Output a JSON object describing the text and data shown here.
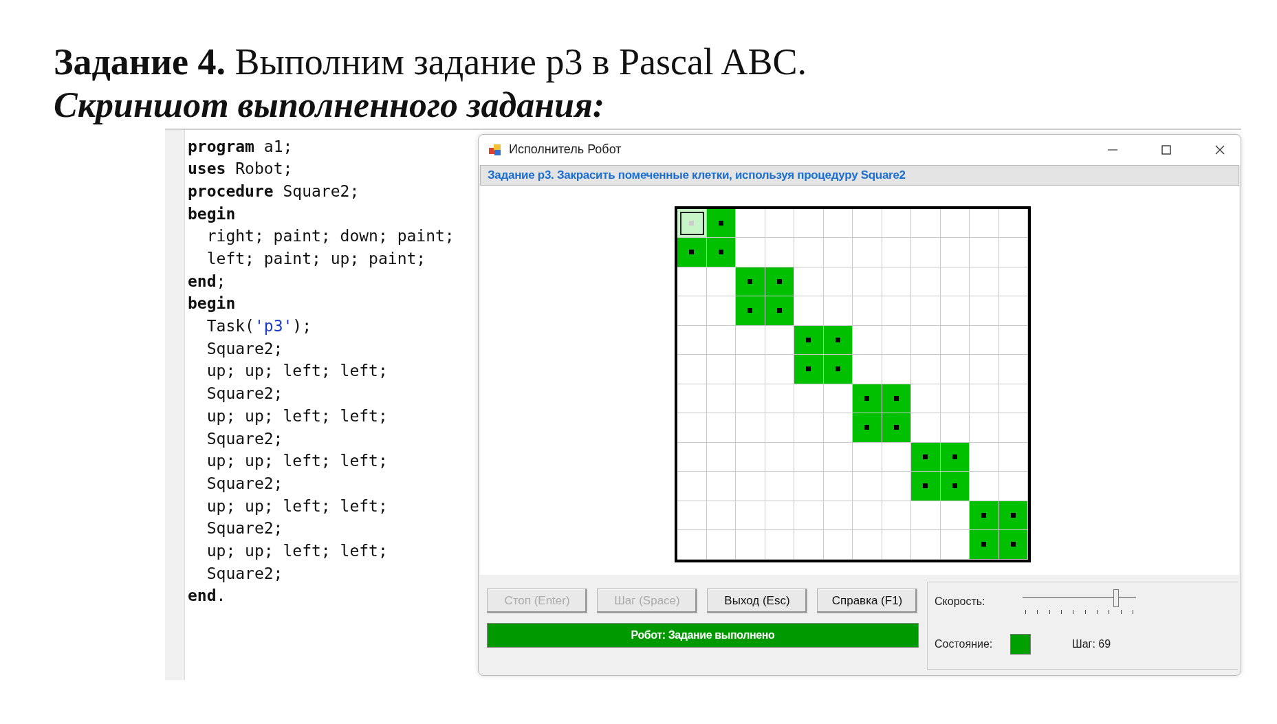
{
  "heading": {
    "number": "Задание 4.",
    "text": "Выполним задание р3 в Pascal ABC."
  },
  "subheading": "Скриншот выполненного задания:",
  "editor": {
    "lines": [
      [
        {
          "kind": "keyword",
          "text": "program"
        },
        {
          "kind": "plain",
          "text": " a1;"
        }
      ],
      [
        {
          "kind": "keyword",
          "text": "uses"
        },
        {
          "kind": "plain",
          "text": " Robot;"
        }
      ],
      [
        {
          "kind": "keyword",
          "text": "procedure"
        },
        {
          "kind": "plain",
          "text": " Square2;"
        }
      ],
      [
        {
          "kind": "keyword",
          "text": "begin"
        }
      ],
      [
        {
          "kind": "plain",
          "text": "  right; paint; down; paint;"
        }
      ],
      [
        {
          "kind": "plain",
          "text": "  left; paint; up; paint;"
        }
      ],
      [
        {
          "kind": "keyword",
          "text": "end"
        },
        {
          "kind": "plain",
          "text": ";"
        }
      ],
      [
        {
          "kind": "keyword",
          "text": "begin"
        }
      ],
      [
        {
          "kind": "plain",
          "text": "  Task("
        },
        {
          "kind": "string",
          "text": "'p3'"
        },
        {
          "kind": "plain",
          "text": ");"
        }
      ],
      [
        {
          "kind": "plain",
          "text": "  Square2;"
        }
      ],
      [
        {
          "kind": "plain",
          "text": "  up; up; left; left;"
        }
      ],
      [
        {
          "kind": "plain",
          "text": "  Square2;"
        }
      ],
      [
        {
          "kind": "plain",
          "text": "  up; up; left; left;"
        }
      ],
      [
        {
          "kind": "plain",
          "text": "  Square2;"
        }
      ],
      [
        {
          "kind": "plain",
          "text": "  up; up; left; left;"
        }
      ],
      [
        {
          "kind": "plain",
          "text": "  Square2;"
        }
      ],
      [
        {
          "kind": "plain",
          "text": "  up; up; left; left;"
        }
      ],
      [
        {
          "kind": "plain",
          "text": "  Square2;"
        }
      ],
      [
        {
          "kind": "plain",
          "text": "  up; up; left; left;"
        }
      ],
      [
        {
          "kind": "plain",
          "text": "  Square2;"
        }
      ],
      [
        {
          "kind": "keyword",
          "text": "end"
        },
        {
          "kind": "plain",
          "text": "."
        }
      ]
    ]
  },
  "window": {
    "title": "Исполнитель Робот",
    "task": "Задание р3. Закрасить помеченные клетки, используя процедуру Square2",
    "grid": [
      [
        {
          "painted": true,
          "marked": true,
          "robot": true
        },
        {
          "painted": true,
          "marked": true,
          "robot": false
        },
        {
          "painted": false,
          "marked": false,
          "robot": false
        },
        {
          "painted": false,
          "marked": false,
          "robot": false
        },
        {
          "painted": false,
          "marked": false,
          "robot": false
        },
        {
          "painted": false,
          "marked": false,
          "robot": false
        },
        {
          "painted": false,
          "marked": false,
          "robot": false
        },
        {
          "painted": false,
          "marked": false,
          "robot": false
        },
        {
          "painted": false,
          "marked": false,
          "robot": false
        },
        {
          "painted": false,
          "marked": false,
          "robot": false
        },
        {
          "painted": false,
          "marked": false,
          "robot": false
        },
        {
          "painted": false,
          "marked": false,
          "robot": false
        }
      ],
      [
        {
          "painted": true,
          "marked": true,
          "robot": false
        },
        {
          "painted": true,
          "marked": true,
          "robot": false
        },
        {
          "painted": false,
          "marked": false,
          "robot": false
        },
        {
          "painted": false,
          "marked": false,
          "robot": false
        },
        {
          "painted": false,
          "marked": false,
          "robot": false
        },
        {
          "painted": false,
          "marked": false,
          "robot": false
        },
        {
          "painted": false,
          "marked": false,
          "robot": false
        },
        {
          "painted": false,
          "marked": false,
          "robot": false
        },
        {
          "painted": false,
          "marked": false,
          "robot": false
        },
        {
          "painted": false,
          "marked": false,
          "robot": false
        },
        {
          "painted": false,
          "marked": false,
          "robot": false
        },
        {
          "painted": false,
          "marked": false,
          "robot": false
        }
      ],
      [
        {
          "painted": false,
          "marked": false,
          "robot": false
        },
        {
          "painted": false,
          "marked": false,
          "robot": false
        },
        {
          "painted": true,
          "marked": true,
          "robot": false
        },
        {
          "painted": true,
          "marked": true,
          "robot": false
        },
        {
          "painted": false,
          "marked": false,
          "robot": false
        },
        {
          "painted": false,
          "marked": false,
          "robot": false
        },
        {
          "painted": false,
          "marked": false,
          "robot": false
        },
        {
          "painted": false,
          "marked": false,
          "robot": false
        },
        {
          "painted": false,
          "marked": false,
          "robot": false
        },
        {
          "painted": false,
          "marked": false,
          "robot": false
        },
        {
          "painted": false,
          "marked": false,
          "robot": false
        },
        {
          "painted": false,
          "marked": false,
          "robot": false
        }
      ],
      [
        {
          "painted": false,
          "marked": false,
          "robot": false
        },
        {
          "painted": false,
          "marked": false,
          "robot": false
        },
        {
          "painted": true,
          "marked": true,
          "robot": false
        },
        {
          "painted": true,
          "marked": true,
          "robot": false
        },
        {
          "painted": false,
          "marked": false,
          "robot": false
        },
        {
          "painted": false,
          "marked": false,
          "robot": false
        },
        {
          "painted": false,
          "marked": false,
          "robot": false
        },
        {
          "painted": false,
          "marked": false,
          "robot": false
        },
        {
          "painted": false,
          "marked": false,
          "robot": false
        },
        {
          "painted": false,
          "marked": false,
          "robot": false
        },
        {
          "painted": false,
          "marked": false,
          "robot": false
        },
        {
          "painted": false,
          "marked": false,
          "robot": false
        }
      ],
      [
        {
          "painted": false,
          "marked": false,
          "robot": false
        },
        {
          "painted": false,
          "marked": false,
          "robot": false
        },
        {
          "painted": false,
          "marked": false,
          "robot": false
        },
        {
          "painted": false,
          "marked": false,
          "robot": false
        },
        {
          "painted": true,
          "marked": true,
          "robot": false
        },
        {
          "painted": true,
          "marked": true,
          "robot": false
        },
        {
          "painted": false,
          "marked": false,
          "robot": false
        },
        {
          "painted": false,
          "marked": false,
          "robot": false
        },
        {
          "painted": false,
          "marked": false,
          "robot": false
        },
        {
          "painted": false,
          "marked": false,
          "robot": false
        },
        {
          "painted": false,
          "marked": false,
          "robot": false
        },
        {
          "painted": false,
          "marked": false,
          "robot": false
        }
      ],
      [
        {
          "painted": false,
          "marked": false,
          "robot": false
        },
        {
          "painted": false,
          "marked": false,
          "robot": false
        },
        {
          "painted": false,
          "marked": false,
          "robot": false
        },
        {
          "painted": false,
          "marked": false,
          "robot": false
        },
        {
          "painted": true,
          "marked": true,
          "robot": false
        },
        {
          "painted": true,
          "marked": true,
          "robot": false
        },
        {
          "painted": false,
          "marked": false,
          "robot": false
        },
        {
          "painted": false,
          "marked": false,
          "robot": false
        },
        {
          "painted": false,
          "marked": false,
          "robot": false
        },
        {
          "painted": false,
          "marked": false,
          "robot": false
        },
        {
          "painted": false,
          "marked": false,
          "robot": false
        },
        {
          "painted": false,
          "marked": false,
          "robot": false
        }
      ],
      [
        {
          "painted": false,
          "marked": false,
          "robot": false
        },
        {
          "painted": false,
          "marked": false,
          "robot": false
        },
        {
          "painted": false,
          "marked": false,
          "robot": false
        },
        {
          "painted": false,
          "marked": false,
          "robot": false
        },
        {
          "painted": false,
          "marked": false,
          "robot": false
        },
        {
          "painted": false,
          "marked": false,
          "robot": false
        },
        {
          "painted": true,
          "marked": true,
          "robot": false
        },
        {
          "painted": true,
          "marked": true,
          "robot": false
        },
        {
          "painted": false,
          "marked": false,
          "robot": false
        },
        {
          "painted": false,
          "marked": false,
          "robot": false
        },
        {
          "painted": false,
          "marked": false,
          "robot": false
        },
        {
          "painted": false,
          "marked": false,
          "robot": false
        }
      ],
      [
        {
          "painted": false,
          "marked": false,
          "robot": false
        },
        {
          "painted": false,
          "marked": false,
          "robot": false
        },
        {
          "painted": false,
          "marked": false,
          "robot": false
        },
        {
          "painted": false,
          "marked": false,
          "robot": false
        },
        {
          "painted": false,
          "marked": false,
          "robot": false
        },
        {
          "painted": false,
          "marked": false,
          "robot": false
        },
        {
          "painted": true,
          "marked": true,
          "robot": false
        },
        {
          "painted": true,
          "marked": true,
          "robot": false
        },
        {
          "painted": false,
          "marked": false,
          "robot": false
        },
        {
          "painted": false,
          "marked": false,
          "robot": false
        },
        {
          "painted": false,
          "marked": false,
          "robot": false
        },
        {
          "painted": false,
          "marked": false,
          "robot": false
        }
      ],
      [
        {
          "painted": false,
          "marked": false,
          "robot": false
        },
        {
          "painted": false,
          "marked": false,
          "robot": false
        },
        {
          "painted": false,
          "marked": false,
          "robot": false
        },
        {
          "painted": false,
          "marked": false,
          "robot": false
        },
        {
          "painted": false,
          "marked": false,
          "robot": false
        },
        {
          "painted": false,
          "marked": false,
          "robot": false
        },
        {
          "painted": false,
          "marked": false,
          "robot": false
        },
        {
          "painted": false,
          "marked": false,
          "robot": false
        },
        {
          "painted": true,
          "marked": true,
          "robot": false
        },
        {
          "painted": true,
          "marked": true,
          "robot": false
        },
        {
          "painted": false,
          "marked": false,
          "robot": false
        },
        {
          "painted": false,
          "marked": false,
          "robot": false
        }
      ],
      [
        {
          "painted": false,
          "marked": false,
          "robot": false
        },
        {
          "painted": false,
          "marked": false,
          "robot": false
        },
        {
          "painted": false,
          "marked": false,
          "robot": false
        },
        {
          "painted": false,
          "marked": false,
          "robot": false
        },
        {
          "painted": false,
          "marked": false,
          "robot": false
        },
        {
          "painted": false,
          "marked": false,
          "robot": false
        },
        {
          "painted": false,
          "marked": false,
          "robot": false
        },
        {
          "painted": false,
          "marked": false,
          "robot": false
        },
        {
          "painted": true,
          "marked": true,
          "robot": false
        },
        {
          "painted": true,
          "marked": true,
          "robot": false
        },
        {
          "painted": false,
          "marked": false,
          "robot": false
        },
        {
          "painted": false,
          "marked": false,
          "robot": false
        }
      ],
      [
        {
          "painted": false,
          "marked": false,
          "robot": false
        },
        {
          "painted": false,
          "marked": false,
          "robot": false
        },
        {
          "painted": false,
          "marked": false,
          "robot": false
        },
        {
          "painted": false,
          "marked": false,
          "robot": false
        },
        {
          "painted": false,
          "marked": false,
          "robot": false
        },
        {
          "painted": false,
          "marked": false,
          "robot": false
        },
        {
          "painted": false,
          "marked": false,
          "robot": false
        },
        {
          "painted": false,
          "marked": false,
          "robot": false
        },
        {
          "painted": false,
          "marked": false,
          "robot": false
        },
        {
          "painted": false,
          "marked": false,
          "robot": false
        },
        {
          "painted": true,
          "marked": true,
          "robot": false
        },
        {
          "painted": true,
          "marked": true,
          "robot": false
        }
      ],
      [
        {
          "painted": false,
          "marked": false,
          "robot": false
        },
        {
          "painted": false,
          "marked": false,
          "robot": false
        },
        {
          "painted": false,
          "marked": false,
          "robot": false
        },
        {
          "painted": false,
          "marked": false,
          "robot": false
        },
        {
          "painted": false,
          "marked": false,
          "robot": false
        },
        {
          "painted": false,
          "marked": false,
          "robot": false
        },
        {
          "painted": false,
          "marked": false,
          "robot": false
        },
        {
          "painted": false,
          "marked": false,
          "robot": false
        },
        {
          "painted": false,
          "marked": false,
          "robot": false
        },
        {
          "painted": false,
          "marked": false,
          "robot": false
        },
        {
          "painted": true,
          "marked": true,
          "robot": false
        },
        {
          "painted": true,
          "marked": true,
          "robot": false
        }
      ]
    ],
    "buttons": [
      {
        "label": "Стоп (Enter)",
        "disabled": true
      },
      {
        "label": "Шаг (Space)",
        "disabled": true
      },
      {
        "label": "Выход (Esc)",
        "disabled": false
      },
      {
        "label": "Справка (F1)",
        "disabled": false
      }
    ],
    "status": "Робот: Задание выполнено",
    "speed": {
      "label": "Скорость:",
      "level": 0.82
    },
    "state": {
      "label": "Состояние:",
      "color": "#00a000"
    },
    "step": "Шаг: 69"
  }
}
